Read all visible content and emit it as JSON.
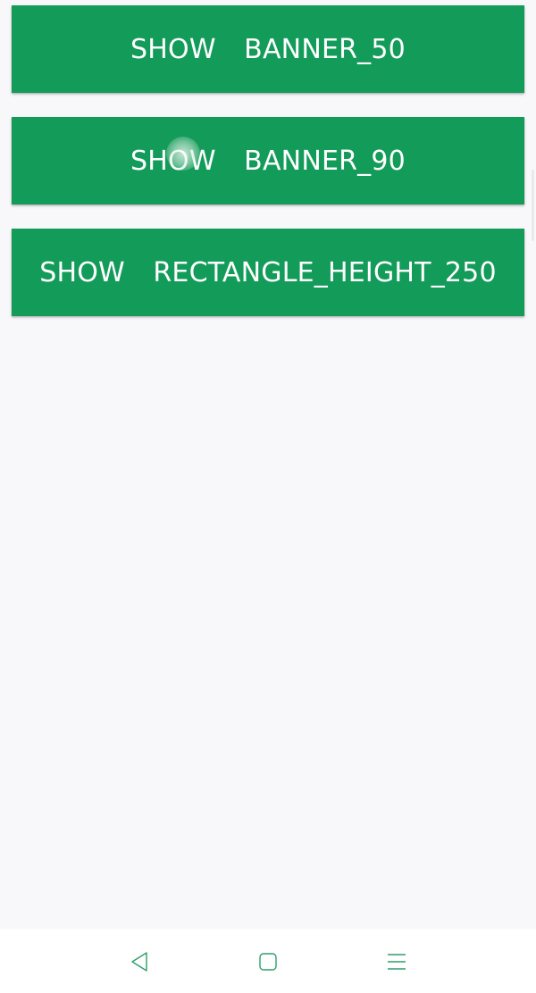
{
  "buttons": [
    {
      "label": "SHOW  BANNER_50"
    },
    {
      "label": "SHOW  BANNER_90"
    },
    {
      "label": "SHOW  RECTANGLE_HEIGHT_250"
    }
  ],
  "navbar": {
    "icons": [
      "back-icon",
      "home-icon",
      "menu-icon"
    ]
  },
  "colors": {
    "button_bg": "#139b59",
    "button_text": "#ffffff",
    "background": "#f8f7fa",
    "navbar_bg": "#ffffff",
    "nav_icon": "#2e9e6a"
  }
}
